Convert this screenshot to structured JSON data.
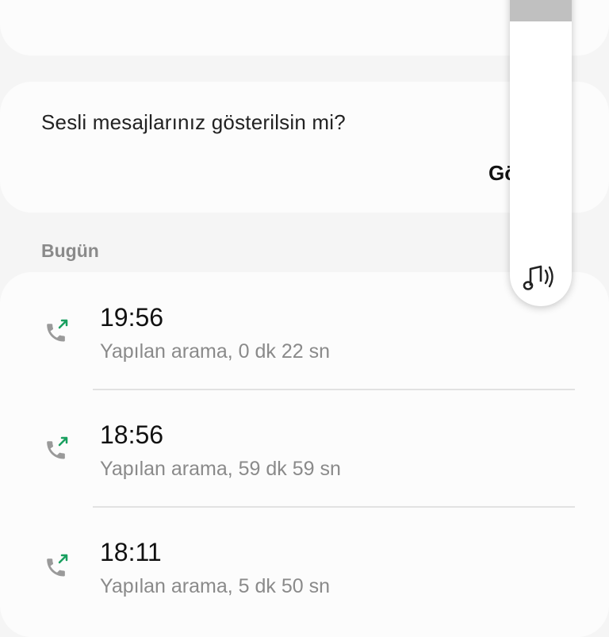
{
  "voice_message": {
    "question": "Sesli mesajlarınız gösterilsin mi?",
    "show_button_label": "Gö"
  },
  "calls_section": {
    "header": "Bugün",
    "items": [
      {
        "time": "19:56",
        "detail": "Yapılan arama, 0 dk 22 sn"
      },
      {
        "time": "18:56",
        "detail": "Yapılan arama, 59 dk 59 sn"
      },
      {
        "time": "18:11",
        "detail": "Yapılan arama, 5 dk 50 sn"
      }
    ]
  },
  "action_buttons": [
    {
      "icon": "phone-icon",
      "color": "#21a04c"
    },
    {
      "icon": "message-icon",
      "color": "#2f9bf0"
    },
    {
      "icon": "video-call-icon",
      "color": "#21a04c"
    }
  ],
  "volume": {
    "level_fraction": 0.17,
    "icon": "media-volume-icon"
  },
  "colors": {
    "outgoing_arrow": "#1aa060",
    "phone_icon_gray": "#9a9a9a"
  }
}
